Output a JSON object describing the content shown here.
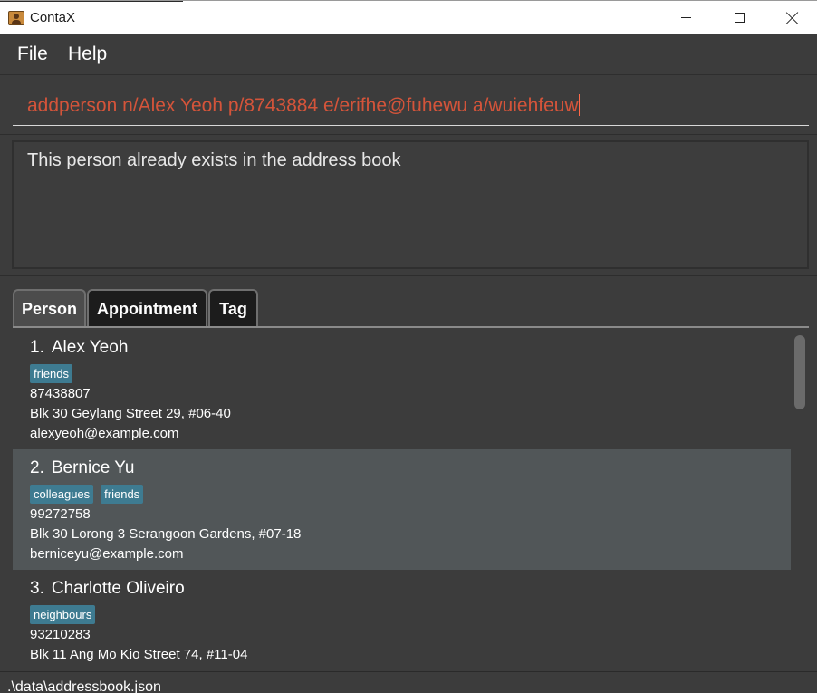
{
  "window": {
    "title": "ContaX",
    "icon": "contacts-book-icon"
  },
  "menu": {
    "items": [
      "File",
      "Help"
    ]
  },
  "command": {
    "value": "addperson n/Alex Yeoh p/8743884 e/erifhe@fuhewu a/wuiehfeuw"
  },
  "result": {
    "message": "This person already exists in the address book"
  },
  "tabs": [
    {
      "label": "Person",
      "selected": true
    },
    {
      "label": "Appointment",
      "selected": false
    },
    {
      "label": "Tag",
      "selected": false
    }
  ],
  "persons": [
    {
      "index": "1.",
      "name": "Alex Yeoh",
      "tags": [
        "friends"
      ],
      "phone": "87438807",
      "address": "Blk 30 Geylang Street 29, #06-40",
      "email": "alexyeoh@example.com"
    },
    {
      "index": "2.",
      "name": "Bernice Yu",
      "tags": [
        "colleagues",
        "friends"
      ],
      "phone": "99272758",
      "address": "Blk 30 Lorong 3 Serangoon Gardens, #07-18",
      "email": "berniceyu@example.com"
    },
    {
      "index": "3.",
      "name": "Charlotte Oliveiro",
      "tags": [
        "neighbours"
      ],
      "phone": "93210283",
      "address": "Blk 11 Ang Mo Kio Street 74, #11-04",
      "email": ""
    }
  ],
  "status": {
    "path": ".\\data\\addressbook.json"
  },
  "colors": {
    "background": "#3c3c3c",
    "command_text": "#d4543a",
    "tag": "#3e7b91",
    "selected_row": "#515658"
  }
}
